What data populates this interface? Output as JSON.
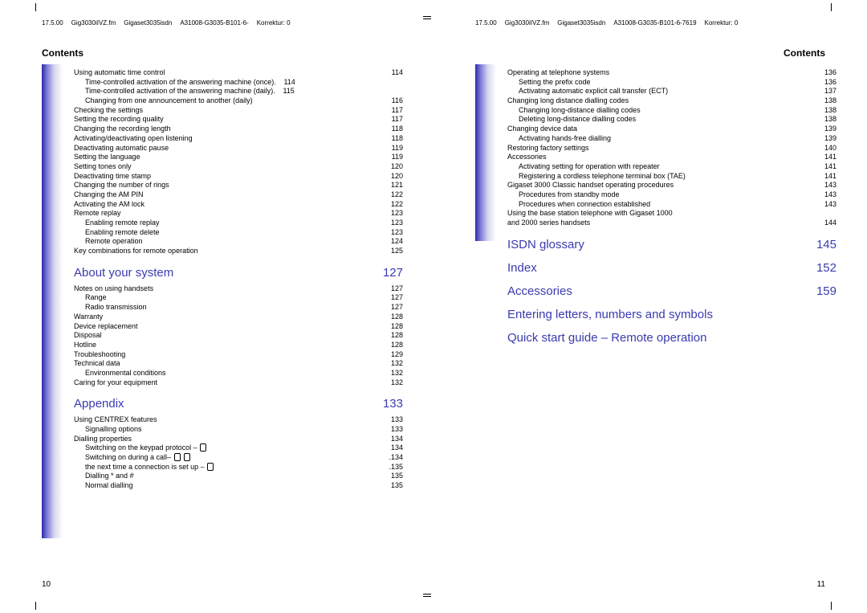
{
  "headerLeft": [
    "17.5.00",
    "Gig3030iIVZ.fm",
    "Gigaset3035isdn",
    "A31008-G3035-B101-6-",
    "Korrektur: 0"
  ],
  "headerRight": [
    "17.5.00",
    "Gig3030iIVZ.fm",
    "Gigaset3035isdn",
    "A31008-G3035-B101-6-7619",
    "Korrektur: 0"
  ],
  "contents": "Contents",
  "leftFooter": "10",
  "rightFooter": "11",
  "leftEntries": [
    {
      "t": "Using automatic time control",
      "p": "114",
      "l": 1
    },
    {
      "t": "Time-controlled activation of the answering machine (once)",
      "p": "114",
      "l": 2,
      "nodots": true,
      "dot": "."
    },
    {
      "t": "Time-controlled activation of the answering machine (daily)",
      "p": "115",
      "l": 2,
      "nodots": true,
      "dot": "."
    },
    {
      "t": "Changing from one announcement to another (daily)",
      "p": "116",
      "l": 2
    },
    {
      "t": "Checking the settings",
      "p": "117",
      "l": 1
    },
    {
      "t": "Setting the recording quality",
      "p": "117",
      "l": 1
    },
    {
      "t": "Changing the recording length",
      "p": "118",
      "l": 1
    },
    {
      "t": "Activating/deactivating open listening",
      "p": "118",
      "l": 1
    },
    {
      "t": "Deactivating automatic pause",
      "p": "119",
      "l": 1
    },
    {
      "t": "Setting the language",
      "p": "119",
      "l": 1
    },
    {
      "t": "Setting tones only",
      "p": "120",
      "l": 1
    },
    {
      "t": "Deactivating time stamp",
      "p": "120",
      "l": 1
    },
    {
      "t": "Changing the number of rings",
      "p": "121",
      "l": 1
    },
    {
      "t": "Changing the AM PIN",
      "p": "122",
      "l": 1
    },
    {
      "t": "Activating the AM lock",
      "p": "122",
      "l": 1
    },
    {
      "t": "Remote replay",
      "p": "123",
      "l": 1
    },
    {
      "t": "Enabling remote replay",
      "p": "123",
      "l": 2
    },
    {
      "t": "Enabling remote delete",
      "p": "123",
      "l": 2
    },
    {
      "t": "Remote operation",
      "p": "124",
      "l": 2
    },
    {
      "t": "Key combinations for remote operation",
      "p": "125",
      "l": 1
    }
  ],
  "sectionAbout": {
    "t": "About your system",
    "p": "127"
  },
  "aboutEntries": [
    {
      "t": "Notes on using handsets",
      "p": "127",
      "l": 1
    },
    {
      "t": "Range",
      "p": "127",
      "l": 2
    },
    {
      "t": "Radio transmission",
      "p": "127",
      "l": 2
    },
    {
      "t": "Warranty",
      "p": "128",
      "l": 1
    },
    {
      "t": "Device replacement",
      "p": "128",
      "l": 1
    },
    {
      "t": "Disposal",
      "p": "128",
      "l": 1
    },
    {
      "t": "Hotline",
      "p": "128",
      "l": 1
    },
    {
      "t": "Troubleshooting",
      "p": "129",
      "l": 1
    },
    {
      "t": "Technical data",
      "p": "132",
      "l": 1
    },
    {
      "t": "Environmental conditions",
      "p": "132",
      "l": 2
    },
    {
      "t": "Caring for your equipment",
      "p": "132",
      "l": 1
    }
  ],
  "sectionAppendix": {
    "t": "Appendix",
    "p": "133"
  },
  "appendixEntries": [
    {
      "t": "Using CENTREX features",
      "p": "133",
      "l": 1
    },
    {
      "t": "Signalling options",
      "p": "133",
      "l": 2
    },
    {
      "t": "Dialling properties",
      "p": "134",
      "l": 1
    },
    {
      "t": "Switching on the keypad protocol –",
      "p": "134",
      "l": 2,
      "icon": 1
    },
    {
      "t": "Switching on during a call–",
      "p": "134",
      "l": 2,
      "icon": 2,
      "lead": true
    },
    {
      "t": "the next time a connection is set up –",
      "p": "135",
      "l": 2,
      "icon": 1,
      "lead": true
    },
    {
      "t": "Dialling * and #",
      "p": "135",
      "l": 2
    },
    {
      "t": "Normal dialling",
      "p": "135",
      "l": 2
    }
  ],
  "rightEntries": [
    {
      "t": "Operating at telephone systems",
      "p": "136",
      "l": 1
    },
    {
      "t": "Setting the prefix code",
      "p": "136",
      "l": 2
    },
    {
      "t": "Activating automatic explicit call transfer (ECT)",
      "p": "137",
      "l": 2
    },
    {
      "t": "Changing long distance dialling codes",
      "p": "138",
      "l": 1
    },
    {
      "t": "Changing long-distance dialling codes",
      "p": "138",
      "l": 2
    },
    {
      "t": "Deleting long-distance dialling codes",
      "p": "138",
      "l": 2
    },
    {
      "t": "Changing device data",
      "p": "139",
      "l": 1
    },
    {
      "t": "Activating hands-free dialling",
      "p": "139",
      "l": 2
    },
    {
      "t": "Restoring factory settings",
      "p": "140",
      "l": 1
    },
    {
      "t": "Accessories",
      "p": "141",
      "l": 1
    },
    {
      "t": "Activating setting for operation with repeater",
      "p": "141",
      "l": 2
    },
    {
      "t": "Registering a cordless telephone terminal box (TAE)",
      "p": "141",
      "l": 2
    },
    {
      "t": "Gigaset 3000 Classic handset operating procedures",
      "p": "143",
      "l": 1
    },
    {
      "t": "Procedures from standby mode",
      "p": "143",
      "l": 2
    },
    {
      "t": "Procedures when connection established",
      "p": "143",
      "l": 2
    },
    {
      "t": "Using the base station telephone with Gigaset 1000",
      "p": "",
      "l": 1,
      "noPg": true
    },
    {
      "t": "and 2000 series handsets",
      "p": "144",
      "l": 1
    }
  ],
  "rightSections": [
    {
      "t": "ISDN glossary",
      "p": "145"
    },
    {
      "t": "Index",
      "p": "152"
    },
    {
      "t": "Accessories",
      "p": "159"
    },
    {
      "t": "Entering letters, numbers and symbols",
      "nop": true
    },
    {
      "t": "Quick start guide – Remote operation",
      "nop": true
    }
  ]
}
